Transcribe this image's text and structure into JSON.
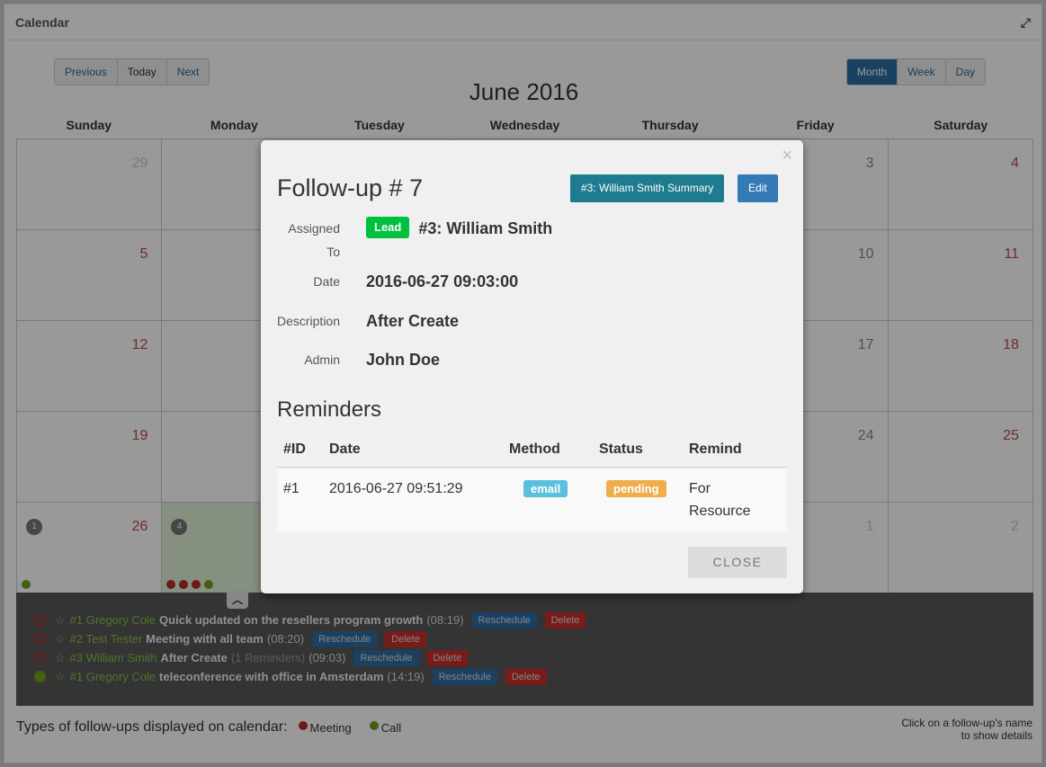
{
  "panel": {
    "title": "Calendar",
    "expand_icon": "expand-icon"
  },
  "nav": {
    "previous": "Previous",
    "today": "Today",
    "next": "Next"
  },
  "views": {
    "month": "Month",
    "week": "Week",
    "day": "Day",
    "active": "Month"
  },
  "month_title": "June 2016",
  "weekdays": [
    "Sunday",
    "Monday",
    "Tuesday",
    "Wednesday",
    "Thursday",
    "Friday",
    "Saturday"
  ],
  "weeks": [
    [
      "29",
      "",
      "",
      "",
      "",
      "3",
      "4"
    ],
    [
      "5",
      "",
      "",
      "",
      "",
      "10",
      "11"
    ],
    [
      "12",
      "",
      "",
      "",
      "",
      "17",
      "18"
    ],
    [
      "19",
      "",
      "",
      "",
      "",
      "24",
      "25"
    ],
    [
      "26",
      "",
      "",
      "",
      "",
      "1",
      "2"
    ]
  ],
  "day_badges": {
    "sunday_26": "1",
    "monday_27": "4"
  },
  "colors": {
    "meeting": "#b52b27",
    "call": "#6e9e1f",
    "today_bg": "#dff0d8",
    "lead": "#00c040",
    "email": "#5bc0de",
    "pending": "#f0ad4e"
  },
  "events": [
    {
      "type": "meeting",
      "who": "#1 Gregory Cole",
      "title": "Quick updated on the resellers program growth",
      "reminders": "",
      "time": "(08:19)"
    },
    {
      "type": "meeting",
      "who": "#2 Test Tester",
      "title": "Meeting with all team",
      "reminders": "",
      "time": "(08:20)"
    },
    {
      "type": "meeting",
      "who": "#3 William Smith",
      "title": "After Create",
      "reminders": "(1 Reminders)",
      "time": "(09:03)"
    },
    {
      "type": "call",
      "who": "#1 Gregory Cole",
      "title": "teleconference with office in Amsterdam",
      "reminders": "",
      "time": "(14:19)"
    }
  ],
  "event_actions": {
    "reschedule": "Reschedule",
    "delete": "Delete"
  },
  "legend": {
    "label": "Types of follow-ups displayed on calendar:",
    "meeting": "Meeting",
    "call": "Call"
  },
  "hint": {
    "line1": "Click on a follow-up's name",
    "line2": "to show details"
  },
  "modal": {
    "title": "Follow-up # 7",
    "summary_button": "#3: William Smith Summary",
    "edit_button": "Edit",
    "assigned_label_1": "Assigned",
    "assigned_label_2": "To",
    "assigned_badge": "Lead",
    "assigned_value": "#3: William Smith",
    "date_label": "Date",
    "date_value": "2016-06-27 09:03:00",
    "description_label": "Description",
    "description_value": "After Create",
    "admin_label": "Admin",
    "admin_value": "John Doe",
    "reminders_title": "Reminders",
    "columns": [
      "#ID",
      "Date",
      "Method",
      "Status",
      "Remind"
    ],
    "reminders": [
      {
        "id": "#1",
        "date": "2016-06-27 09:51:29",
        "method": "email",
        "status": "pending",
        "remind_1": "For",
        "remind_2": "Resource"
      }
    ],
    "close": "CLOSE"
  }
}
